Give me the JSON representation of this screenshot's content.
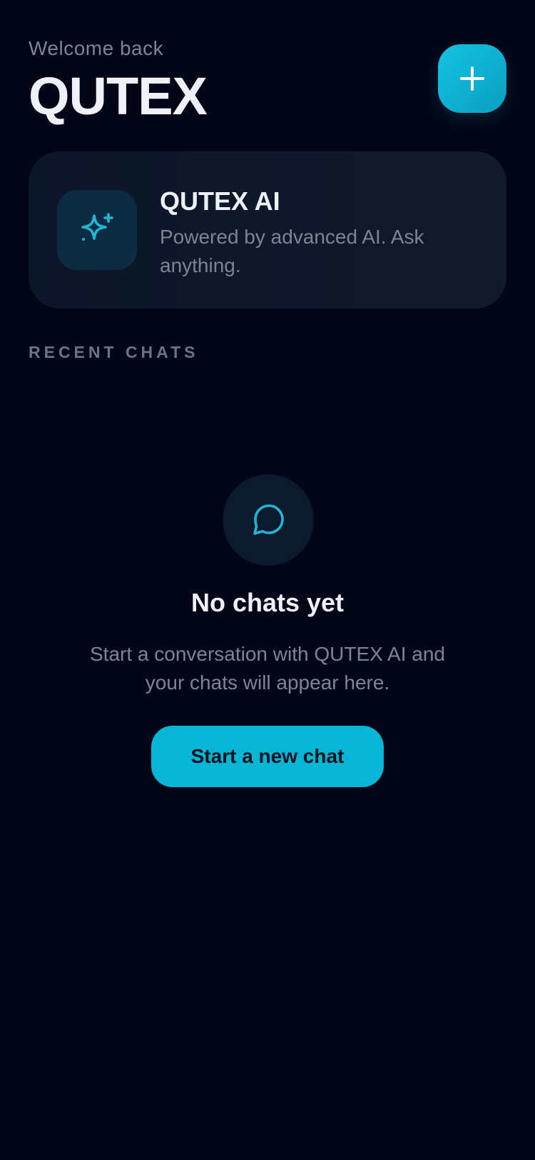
{
  "header": {
    "welcome": "Welcome back",
    "brand": "QUTEX",
    "new_chat_icon": "plus-icon"
  },
  "ai_card": {
    "icon": "sparkles-icon",
    "title": "QUTEX AI",
    "subtitle": "Powered by advanced AI. Ask anything."
  },
  "recent_chats": {
    "label": "RECENT CHATS",
    "empty_state": {
      "icon": "chat-bubble-icon",
      "title": "No chats yet",
      "description": "Start a conversation with QUTEX AI and your chats will appear here.",
      "button_label": "Start a new chat"
    }
  },
  "colors": {
    "background": "#030617",
    "accent": "#06b6d4",
    "text_primary": "#eef1f7",
    "text_secondary": "#7c8598"
  }
}
